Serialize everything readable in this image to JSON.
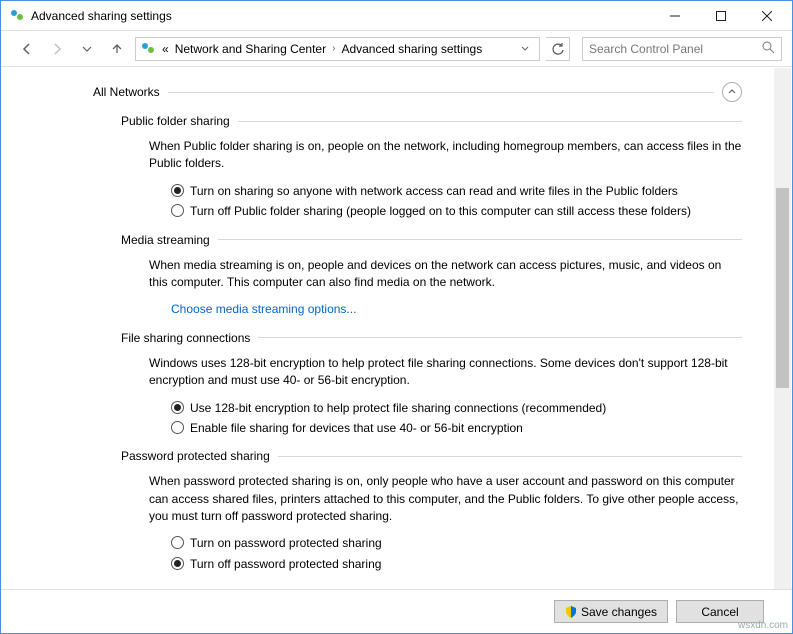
{
  "window": {
    "title": "Advanced sharing settings"
  },
  "breadcrumb": {
    "prefix": "«",
    "seg1": "Network and Sharing Center",
    "seg2": "Advanced sharing settings"
  },
  "search": {
    "placeholder": "Search Control Panel"
  },
  "profile": {
    "name": "All Networks"
  },
  "sections": {
    "publicFolder": {
      "title": "Public folder sharing",
      "desc": "When Public folder sharing is on, people on the network, including homegroup members, can access files in the Public folders.",
      "opt1": "Turn on sharing so anyone with network access can read and write files in the Public folders",
      "opt2": "Turn off Public folder sharing (people logged on to this computer can still access these folders)"
    },
    "media": {
      "title": "Media streaming",
      "desc": "When media streaming is on, people and devices on the network can access pictures, music, and videos on this computer. This computer can also find media on the network.",
      "link": "Choose media streaming options..."
    },
    "fileSharing": {
      "title": "File sharing connections",
      "desc": "Windows uses 128-bit encryption to help protect file sharing connections. Some devices don't support 128-bit encryption and must use 40- or 56-bit encryption.",
      "opt1": "Use 128-bit encryption to help protect file sharing connections (recommended)",
      "opt2": "Enable file sharing for devices that use 40- or 56-bit encryption"
    },
    "password": {
      "title": "Password protected sharing",
      "desc": "When password protected sharing is on, only people who have a user account and password on this computer can access shared files, printers attached to this computer, and the Public folders. To give other people access, you must turn off password protected sharing.",
      "opt1": "Turn on password protected sharing",
      "opt2": "Turn off password protected sharing"
    }
  },
  "footer": {
    "save": "Save changes",
    "cancel": "Cancel"
  },
  "watermark": "wsxdn.com"
}
